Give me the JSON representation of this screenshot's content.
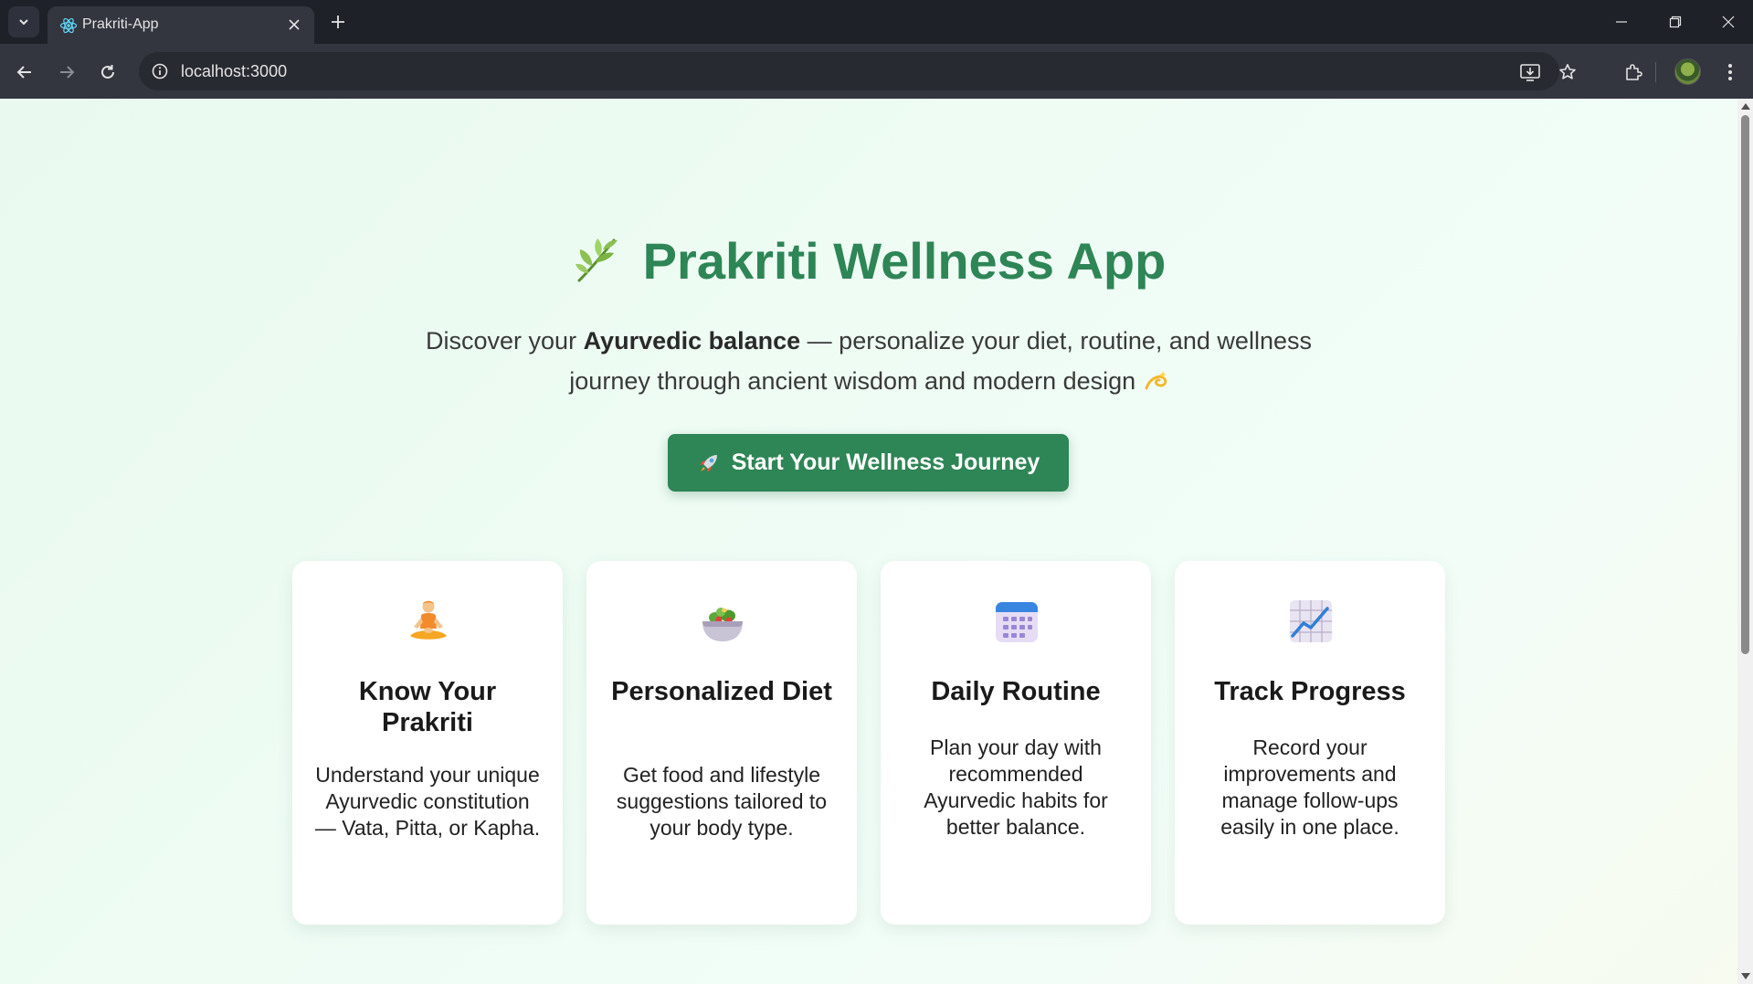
{
  "browser": {
    "tab_title": "Prakriti-App",
    "url": "localhost:3000"
  },
  "hero": {
    "title": "Prakriti Wellness App",
    "subtitle_before": "Discover your ",
    "subtitle_bold": "Ayurvedic balance",
    "subtitle_after": " — personalize your diet, routine, and wellness journey through ancient wisdom and modern design",
    "cta_label": "Start Your Wellness Journey"
  },
  "cards": [
    {
      "title": "Know Your Prakriti",
      "description": "Understand your unique Ayurvedic constitution — Vata, Pitta, or Kapha.",
      "icon": "meditation-icon"
    },
    {
      "title": "Personalized Diet",
      "description": "Get food and lifestyle suggestions tailored to your body type.",
      "icon": "salad-bowl-icon"
    },
    {
      "title": "Daily Routine",
      "description": "Plan your day with recommended Ayurvedic habits for better balance.",
      "icon": "calendar-icon"
    },
    {
      "title": "Track Progress",
      "description": "Record your improvements and manage follow-ups easily in one place.",
      "icon": "chart-increasing-icon"
    }
  ],
  "colors": {
    "brand_green": "#2e8556",
    "background": "#eefcf4",
    "browser_frame": "#1f2129"
  }
}
